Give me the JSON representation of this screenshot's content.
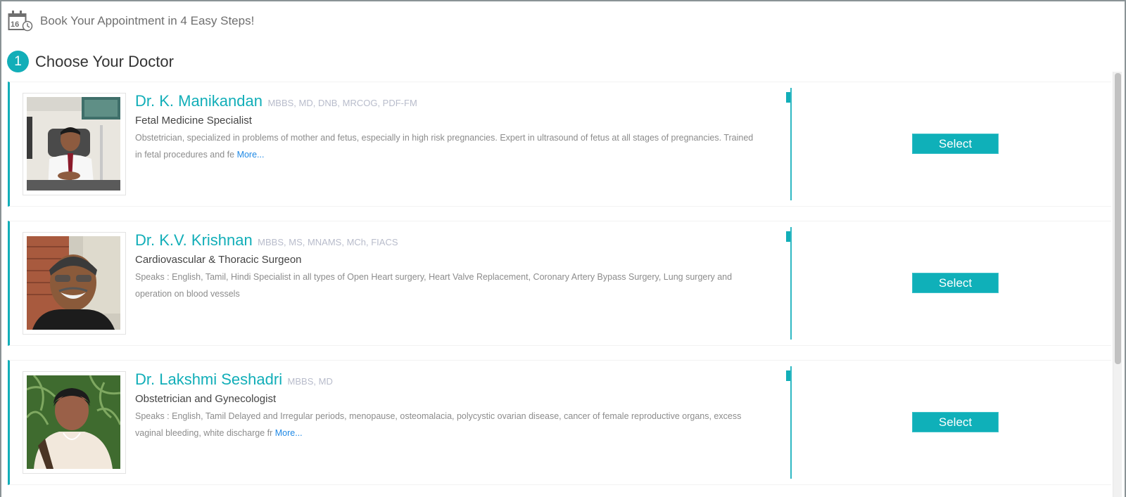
{
  "header": {
    "icon": "calendar-clock-icon",
    "calendar_day": "16",
    "title": "Book Your Appointment in 4 Easy Steps!"
  },
  "step": {
    "number": "1",
    "title": "Choose Your Doctor"
  },
  "colors": {
    "accent": "#12aeb8",
    "link": "#1e88e5",
    "qualifications": "#b8bccb"
  },
  "doctors": [
    {
      "name": "Dr. K. Manikandan",
      "qualifications": "MBBS, MD, DNB, MRCOG, PDF-FM",
      "specialty": "Fetal Medicine Specialist",
      "description": "Obstetrician, specialized in problems of mother and fetus, especially in high risk pregnancies. Expert in ultrasound of fetus at all stages of pregnancies. Trained in fetal procedures and fe",
      "more_label": "More...",
      "select_label": "Select",
      "photo": "doctor-photo-man-white-coat"
    },
    {
      "name": "Dr. K.V. Krishnan",
      "qualifications": "MBBS, MS, MNAMS, MCh, FIACS",
      "specialty": "Cardiovascular & Thoracic Surgeon",
      "description": "Speaks : English, Tamil, Hindi Specialist in all types of Open Heart surgery, Heart Valve Replacement, Coronary Artery Bypass Surgery, Lung surgery and operation on blood vessels",
      "more_label": "",
      "select_label": "Select",
      "photo": "doctor-photo-man-glasses"
    },
    {
      "name": "Dr. Lakshmi Seshadri",
      "qualifications": "MBBS, MD",
      "specialty": "Obstetrician and Gynecologist",
      "description": "Speaks : English, Tamil Delayed and Irregular periods, menopause, osteomalacia, polycystic ovarian disease, cancer of female reproductive organs, excess vaginal bleeding, white discharge fr",
      "more_label": "More...",
      "select_label": "Select",
      "photo": "doctor-photo-woman-saree"
    }
  ]
}
